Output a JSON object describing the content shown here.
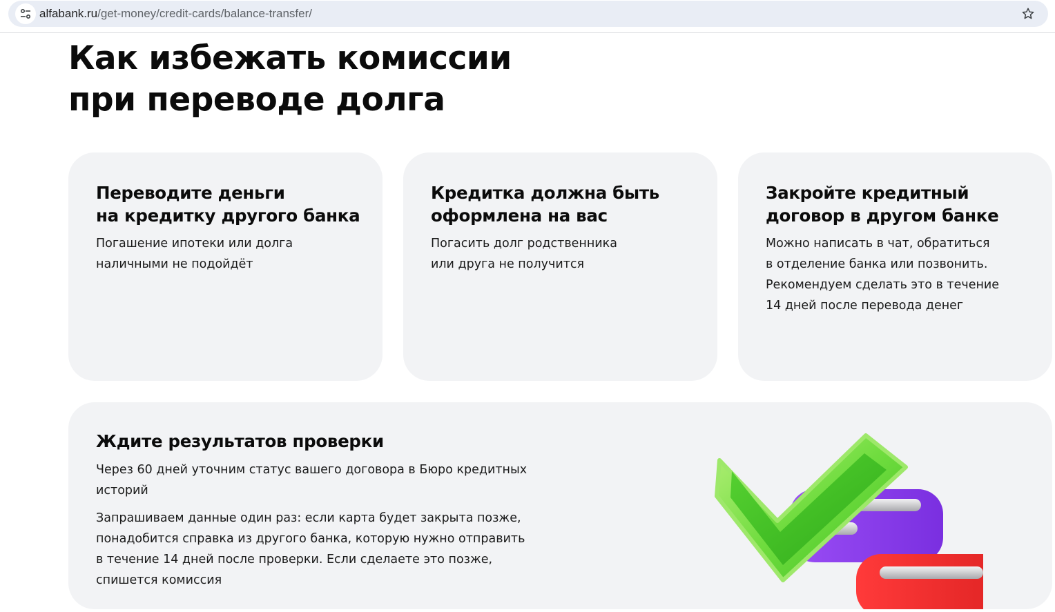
{
  "browser": {
    "url_host": "alfabank.ru",
    "url_path": "/get-money/credit-cards/balance-transfer/",
    "site_info_icon": "tune-icon",
    "bookmark_icon": "star-icon"
  },
  "page": {
    "heading_line1": "Как избежать комиссии",
    "heading_line2": "при переводе долга"
  },
  "cards": [
    {
      "title_line1": "Переводите деньги",
      "title_line2": "на кредитку другого банка",
      "text_lines": [
        "Погашение ипотеки или долга",
        "наличными не подойдёт"
      ]
    },
    {
      "title_line1": "Кредитка должна быть",
      "title_line2": "оформлена на вас",
      "text_lines": [
        "Погасить долг родственника",
        "или друга не получится"
      ]
    },
    {
      "title_line1": "Закройте кредитный",
      "title_line2": "договор в другом банке",
      "text_lines": [
        "Можно написать в чат, обратиться",
        "в отделение банка или позвонить.",
        "Рекомендуем сделать это в течение",
        "14 дней после перевода денег"
      ]
    }
  ],
  "check_card": {
    "title": "Ждите результатов проверки",
    "para1_lines": [
      "Через 60 дней уточним статус вашего договора в Бюро кредитных",
      "историй"
    ],
    "para2_lines": [
      "Запрашиваем данные один раз: если карта будет закрыта позже,",
      "понадобится справка из другого банка, которую нужно отправить",
      "в течение 14 дней после проверки. Если сделаете это позже,",
      "спишется комиссия"
    ],
    "illustration": "checkmark-list-illustration",
    "colors": {
      "check": "#5fd13a",
      "purple": "#8a3cf0",
      "red": "#ef2b2b",
      "bar": "#c9c9cc"
    }
  }
}
